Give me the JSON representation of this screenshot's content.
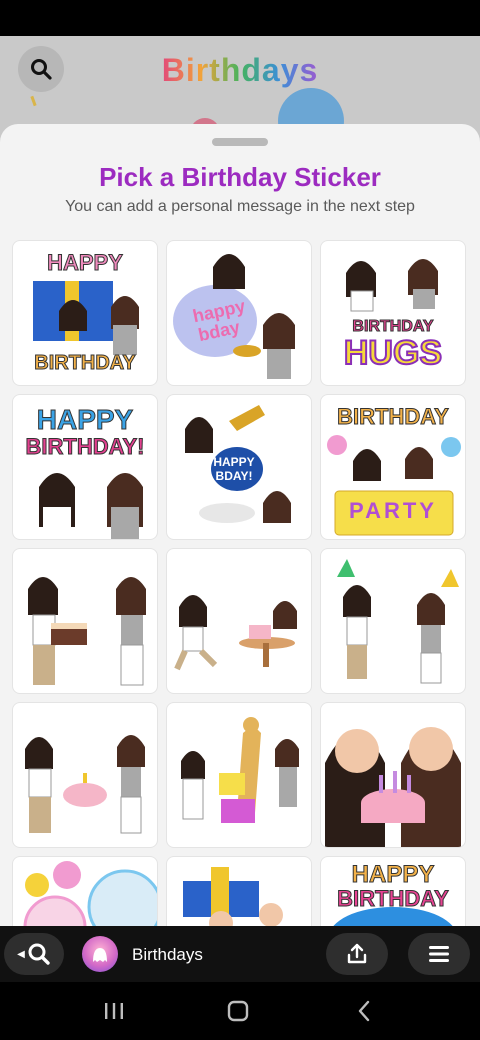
{
  "backdrop": {
    "title": "Birthdays"
  },
  "sheet": {
    "title": "Pick a Birthday Sticker",
    "subtitle": "You can add a personal message in the next step"
  },
  "stickers": [
    {
      "label_top": "HAPPY",
      "label_bottom": "BIRTHDAY"
    },
    {
      "label_top": "happy",
      "label_bottom": "bday"
    },
    {
      "label_top": "BIRTHDAY",
      "label_bottom": "HUGS"
    },
    {
      "label_top": "HAPPY",
      "label_bottom": "BIRTHDAY!"
    },
    {
      "label_top": "HAPPY",
      "label_bottom": "BDAY!"
    },
    {
      "label_top": "BIRTHDAY",
      "label_bottom": "PARTY"
    },
    {
      "label_top": "",
      "label_bottom": ""
    },
    {
      "label_top": "",
      "label_bottom": ""
    },
    {
      "label_top": "",
      "label_bottom": ""
    },
    {
      "label_top": "",
      "label_bottom": ""
    },
    {
      "label_top": "",
      "label_bottom": ""
    },
    {
      "label_top": "",
      "label_bottom": ""
    },
    {
      "label_top": "",
      "label_bottom": ""
    },
    {
      "label_top": "",
      "label_bottom": ""
    },
    {
      "label_top": "HAPPY",
      "label_bottom": "BIRTHDAY"
    }
  ],
  "bottom_bar": {
    "lens_name": "Birthdays"
  },
  "colors": {
    "title_purple": "#9c2bc0",
    "sheet_bg": "#f3f3f3",
    "bar_bg": "#111111"
  },
  "icons": {
    "search": "search-icon",
    "share": "share-icon",
    "menu": "menu-icon"
  }
}
